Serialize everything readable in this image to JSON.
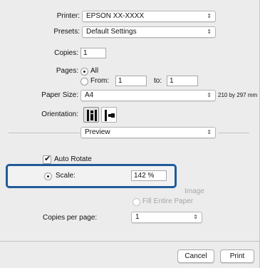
{
  "printer": {
    "label": "Printer:",
    "value": "EPSON XX-XXXX"
  },
  "presets": {
    "label": "Presets:",
    "value": "Default Settings"
  },
  "copies": {
    "label": "Copies:",
    "value": "1"
  },
  "pages": {
    "label": "Pages:",
    "all_label": "All",
    "from_label": "From:",
    "from_value": "1",
    "to_label": "to:",
    "to_value": "1"
  },
  "paper_size": {
    "label": "Paper Size:",
    "value": "A4",
    "dimensions": "210 by 297 mm"
  },
  "orientation": {
    "label": "Orientation:"
  },
  "section_popup": {
    "value": "Preview"
  },
  "auto_rotate": {
    "label": "Auto Rotate",
    "checked": true
  },
  "scale": {
    "label": "Scale:",
    "value": "142 %",
    "selected": true
  },
  "scale_to_fit": {
    "image_label": "Image",
    "fill_label": "Fill Entire Paper"
  },
  "copies_per_page": {
    "label": "Copies per page:",
    "value": "1"
  },
  "buttons": {
    "cancel": "Cancel",
    "print": "Print"
  }
}
